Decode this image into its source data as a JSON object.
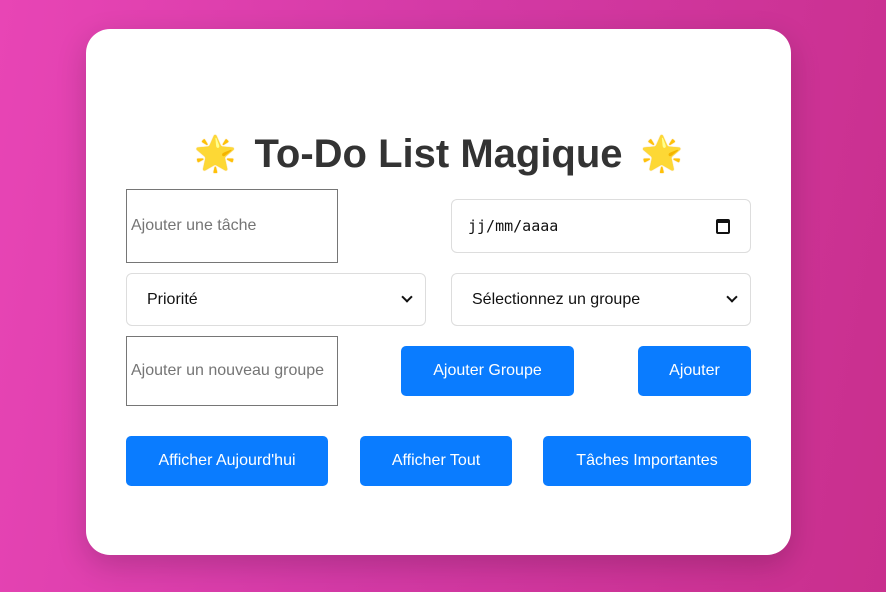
{
  "header": {
    "title": "To-Do List Magique",
    "star_icon": "✨"
  },
  "form": {
    "task_placeholder": "Ajouter une tâche",
    "date_placeholder": "jj/mm/aaaa",
    "priority_selected": "Priorité",
    "group_selected": "Sélectionnez un groupe",
    "new_group_placeholder": "Ajouter un nouveau groupe",
    "add_group_label": "Ajouter Groupe",
    "add_label": "Ajouter"
  },
  "filters": {
    "today_label": "Afficher Aujourd'hui",
    "all_label": "Afficher Tout",
    "important_label": "Tâches Importantes"
  },
  "colors": {
    "accent": "#0a7cff",
    "background_start": "#e845b5",
    "background_end": "#c92f8d",
    "title": "#333333"
  }
}
